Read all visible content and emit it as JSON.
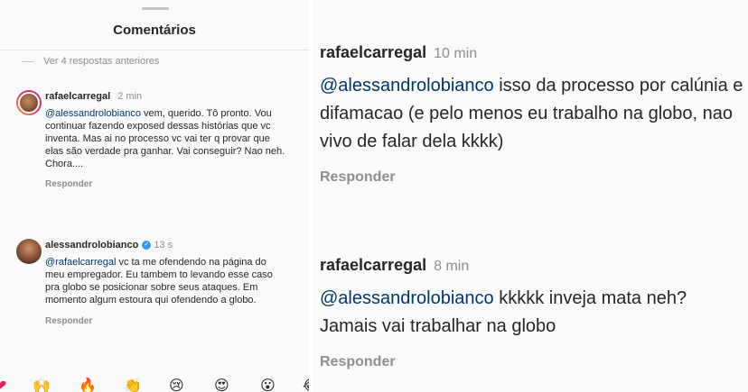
{
  "left": {
    "title": "Comentários",
    "view_previous": "Ver 4 respostas anteriores",
    "comments": [
      {
        "username": "rafaelcarregal",
        "time": "2 min",
        "mention": "@alessandrolobianco",
        "text": " vem, querido. Tô pronto. Vou continuar fazendo exposed dessas histórias que vc inventa. Mas ai no processo vc vai ter q provar que elas são verdade pra ganhar. Vai conseguir? Nao neh. Chora....",
        "reply": "Responder"
      },
      {
        "username": "alessandrolobianco",
        "verified": "✓",
        "time": "13 s",
        "mention": "@rafaelcarregal",
        "text": " vc ta me ofendendo na página do meu empregador. Eu tambem to levando esse caso pra globo se posicionar sobre seus ataques. Em momento algum estoura qui ofendendo a globo.",
        "reply": "Responder"
      }
    ],
    "emojis": [
      "❤",
      "🙌",
      "🔥",
      "👏",
      "😢",
      "😍",
      "😮",
      "😂"
    ]
  },
  "right": {
    "comments": [
      {
        "username": "rafaelcarregal",
        "time": "10 min",
        "mention": "@alessandrolobianco",
        "text": " isso da processo por calúnia e difamacao (e pelo menos eu trabalho na globo, nao vivo de falar dela kkkk)",
        "reply": "Responder"
      },
      {
        "username": "rafaelcarregal",
        "time": "8 min",
        "mention": "@alessandrolobianco",
        "text": " kkkkk inveja mata neh? Jamais vai trabalhar na globo",
        "reply": "Responder"
      }
    ]
  },
  "colors": {
    "background": "#fafafa",
    "text": "#262626",
    "secondary": "#8e8e8e",
    "mention": "#00376b",
    "verified": "#3897f0"
  }
}
